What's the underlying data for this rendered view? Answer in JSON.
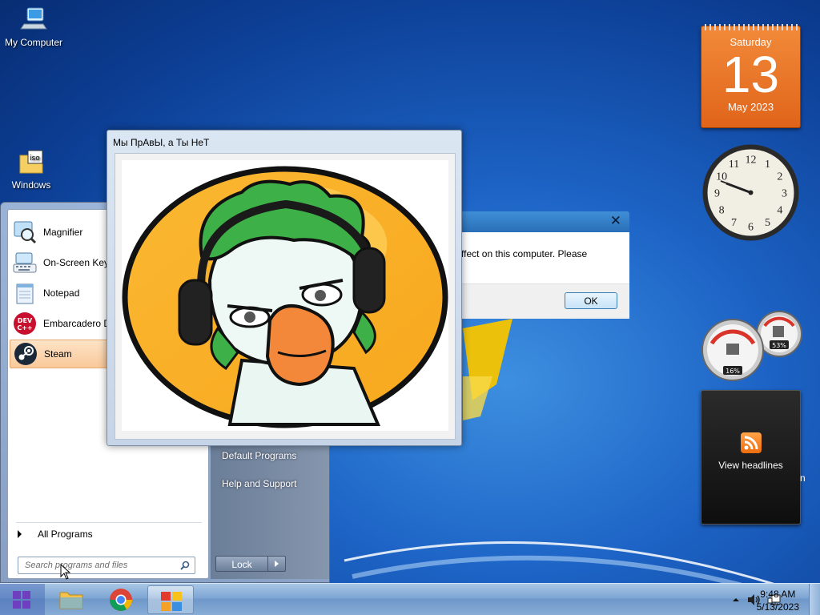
{
  "desktop": {
    "icons": [
      {
        "label": "My Computer",
        "icon": "computer-icon"
      },
      {
        "label": "Windows",
        "icon": "iso-file-icon"
      }
    ]
  },
  "gadgets": {
    "calendar": {
      "weekday": "Saturday",
      "day": "13",
      "month_year": "May 2023"
    },
    "clock": {
      "numerals": [
        "12",
        "1",
        "2",
        "3",
        "4",
        "5",
        "6",
        "7",
        "8",
        "9",
        "10",
        "11"
      ]
    },
    "cpu_meter": {
      "cpu": "16%",
      "memory": "53%"
    },
    "feed": {
      "label": "View headlines",
      "icon": "rss-icon",
      "clipped_text": "n"
    }
  },
  "start_menu": {
    "programs": [
      {
        "label": "Magnifier",
        "icon": "magnifier-icon"
      },
      {
        "label": "On-Screen Keyb",
        "icon": "keyboard-icon"
      },
      {
        "label": "Notepad",
        "icon": "notepad-icon"
      },
      {
        "label": "Embarcadero D",
        "icon": "devcpp-icon"
      },
      {
        "label": "Steam",
        "icon": "steam-icon"
      }
    ],
    "all_programs": "All Programs",
    "search_placeholder": "Search programs and files",
    "right_links": [
      "Default Programs",
      "Help and Support"
    ],
    "lock_label": "Lock",
    "devcpp_badge": [
      "DEV",
      "C++"
    ]
  },
  "bg_dialog": {
    "message": "ffect on this computer. Please",
    "ok_label": "OK",
    "close_glyph": "✕"
  },
  "image_window": {
    "title": "Мы ПрАвЫ, а Ты НеТ",
    "image": "goose-with-headphones"
  },
  "taskbar": {
    "apps": [
      {
        "name": "file-explorer",
        "icon": "folder-icon"
      },
      {
        "name": "chrome",
        "icon": "chrome-icon"
      },
      {
        "name": "image-app",
        "icon": "paint-icon",
        "active": true
      }
    ],
    "time": "9:48 AM",
    "date": "5/13/2023"
  },
  "colors": {
    "calendar": "#e8701f",
    "accent": "#1d64c6",
    "selection": "#f9c99a"
  }
}
